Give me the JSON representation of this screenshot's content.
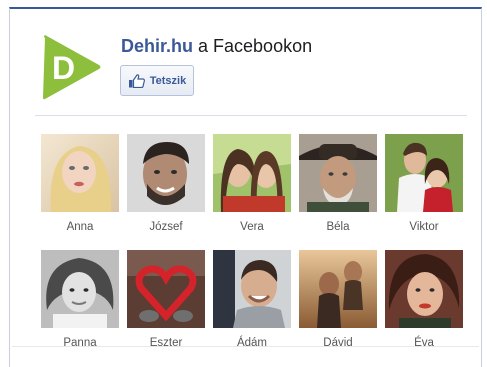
{
  "header": {
    "brand": "Dehir.hu",
    "suffix": " a Facebookon",
    "like_label": "Tetszik"
  },
  "colors": {
    "facebook_blue": "#3b5998",
    "logo_green": "#8dbf3c"
  },
  "friends": [
    {
      "name": "Anna"
    },
    {
      "name": "József"
    },
    {
      "name": "Vera"
    },
    {
      "name": "Béla"
    },
    {
      "name": "Viktor"
    },
    {
      "name": "Panna"
    },
    {
      "name": "Eszter"
    },
    {
      "name": "Ádám"
    },
    {
      "name": "Dávid"
    },
    {
      "name": "Éva"
    }
  ]
}
